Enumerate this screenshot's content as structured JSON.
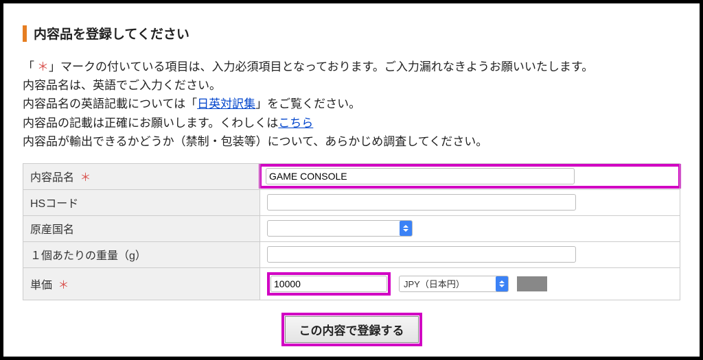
{
  "title": "内容品を登録してください",
  "intro": {
    "line1_a": "「",
    "line1_star": "＊",
    "line1_b": "」マークの付いている項目は、入力必須項目となっております。ご入力漏れなきようお願いいたします。",
    "line2": "内容品名は、英語でご入力ください。",
    "line3_a": "内容品名の英語記載については「",
    "line3_link": "日英対訳集",
    "line3_b": "」をご覧ください。",
    "line4_a": "内容品の記載は正確にお願いします。くわしくは",
    "line4_link": "こちら",
    "line5": "内容品が輸出できるかどうか（禁制・包装等）について、あらかじめ調査してください。"
  },
  "fields": {
    "name": {
      "label": "内容品名",
      "required": true,
      "value": "GAME CONSOLE"
    },
    "hs": {
      "label": "HSコード",
      "required": false,
      "value": ""
    },
    "origin": {
      "label": "原産国名",
      "required": false,
      "selected": ""
    },
    "weight": {
      "label": "１個あたりの重量（g）",
      "required": false,
      "value": ""
    },
    "price": {
      "label": "単価",
      "required": true,
      "value": "10000",
      "currency": "JPY（日本円）"
    }
  },
  "submit_label": "この内容で登録する",
  "required_mark": "＊"
}
